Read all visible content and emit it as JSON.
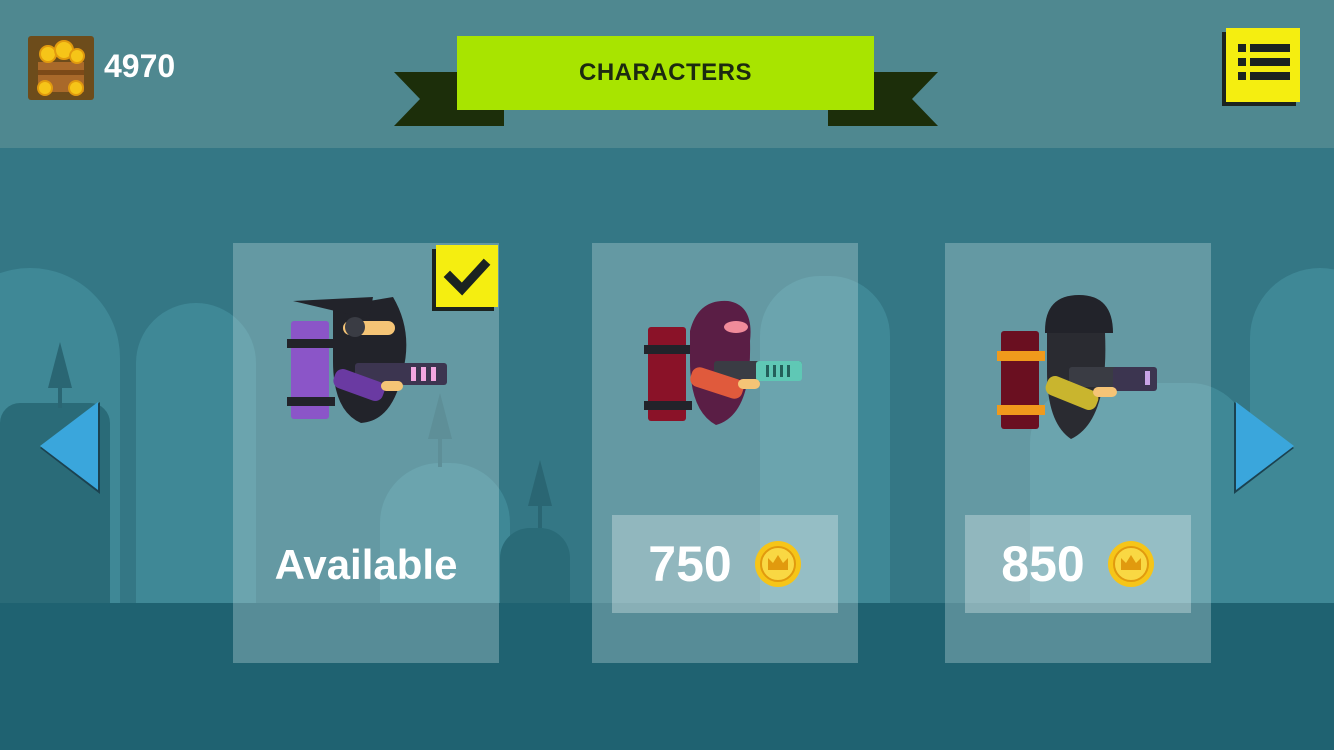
{
  "header": {
    "coins": "4970",
    "title": "CHARACTERS"
  },
  "characters": [
    {
      "status_label": "Available",
      "selected": true,
      "suit_color": "#7a3fb5"
    },
    {
      "price": "750",
      "selected": false,
      "suit_color": "#e05a3c"
    },
    {
      "price": "850",
      "selected": false,
      "suit_color": "#d8c23a"
    }
  ],
  "icons": {
    "coin_icon": "crown-coin-icon",
    "menu_icon": "list-menu-icon",
    "check_icon": "checkmark-icon",
    "treasure_icon": "treasure-chest-icon"
  },
  "colors": {
    "banner": "#a8e400",
    "accent_yellow": "#f5ee10",
    "arrow_blue": "#3aa6dc"
  }
}
